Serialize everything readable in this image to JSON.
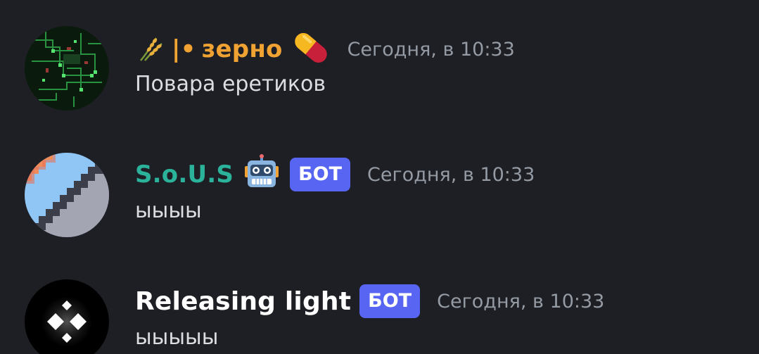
{
  "messages": [
    {
      "author": {
        "prefix": "|•",
        "name": "зерно",
        "color": "#f0a232",
        "leading_icon": "rice-sheaf-icon",
        "trailing_icon": "pill-icon"
      },
      "timestamp": "Сегодня, в 10:33",
      "content": "Повара еретиков",
      "avatar": "green-circuit-avatar"
    },
    {
      "author": {
        "name": "S.o.U.S",
        "color": "#2bb29a",
        "trailing_icon": "robot-icon"
      },
      "badge": "БОТ",
      "timestamp": "Сегодня, в 10:33",
      "content": "ыыыы",
      "avatar": "pixel-stairs-avatar"
    },
    {
      "author": {
        "name": "Releasing light",
        "color": "#ffffff"
      },
      "badge": "БОТ",
      "timestamp": "Сегодня, в 10:33",
      "content": "ыыыыы",
      "avatar": "glowing-diamonds-avatar"
    }
  ]
}
